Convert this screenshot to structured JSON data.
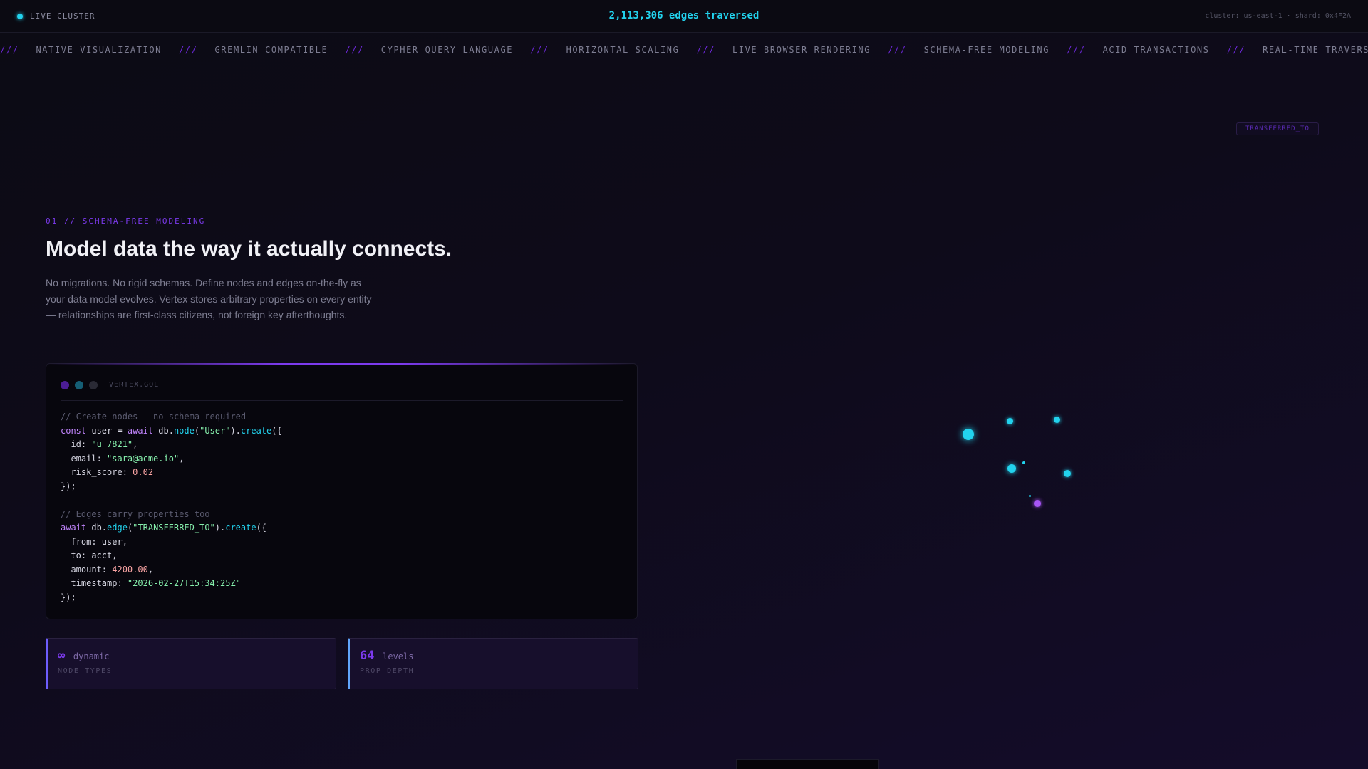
{
  "topbar": {
    "live_label": "LIVE CLUSTER",
    "edges_text": "2,113,306 edges traversed",
    "cluster_info": "cluster: us-east-1 · shard: 0x4F2A"
  },
  "ticker": {
    "separator": "///",
    "items": [
      "NATIVE VISUALIZATION",
      "GREMLIN COMPATIBLE",
      "CYPHER QUERY LANGUAGE",
      "HORIZONTAL SCALING",
      "LIVE BROWSER RENDERING",
      "SCHEMA-FREE MODELING",
      "ACID TRANSACTIONS",
      "REAL-TIME TRAVERSAL"
    ]
  },
  "section": {
    "eyebrow": "01 // SCHEMA-FREE MODELING",
    "headline": "Model data the way it actually connects.",
    "body": "No migrations. No rigid schemas. Define nodes and edges on-the-fly as your data model evolves. Vertex stores arbitrary properties on every entity — relationships are first-class citizens, not foreign key afterthoughts."
  },
  "code_card": {
    "filename": "VERTEX.GQL"
  },
  "stats": [
    {
      "value": "∞",
      "unit": "dynamic",
      "label": "NODE TYPES"
    },
    {
      "value": "64",
      "unit": "levels",
      "label": "PROP DEPTH"
    }
  ],
  "graph": {
    "edge_label": "TRANSFERRED_TO",
    "node_color_primary": "#22d3ee",
    "node_color_secondary": "#a855f7"
  },
  "colors": {
    "accent_cyan": "#22d3ee",
    "accent_purple": "#7c3aed",
    "background": "#0c0b14"
  }
}
